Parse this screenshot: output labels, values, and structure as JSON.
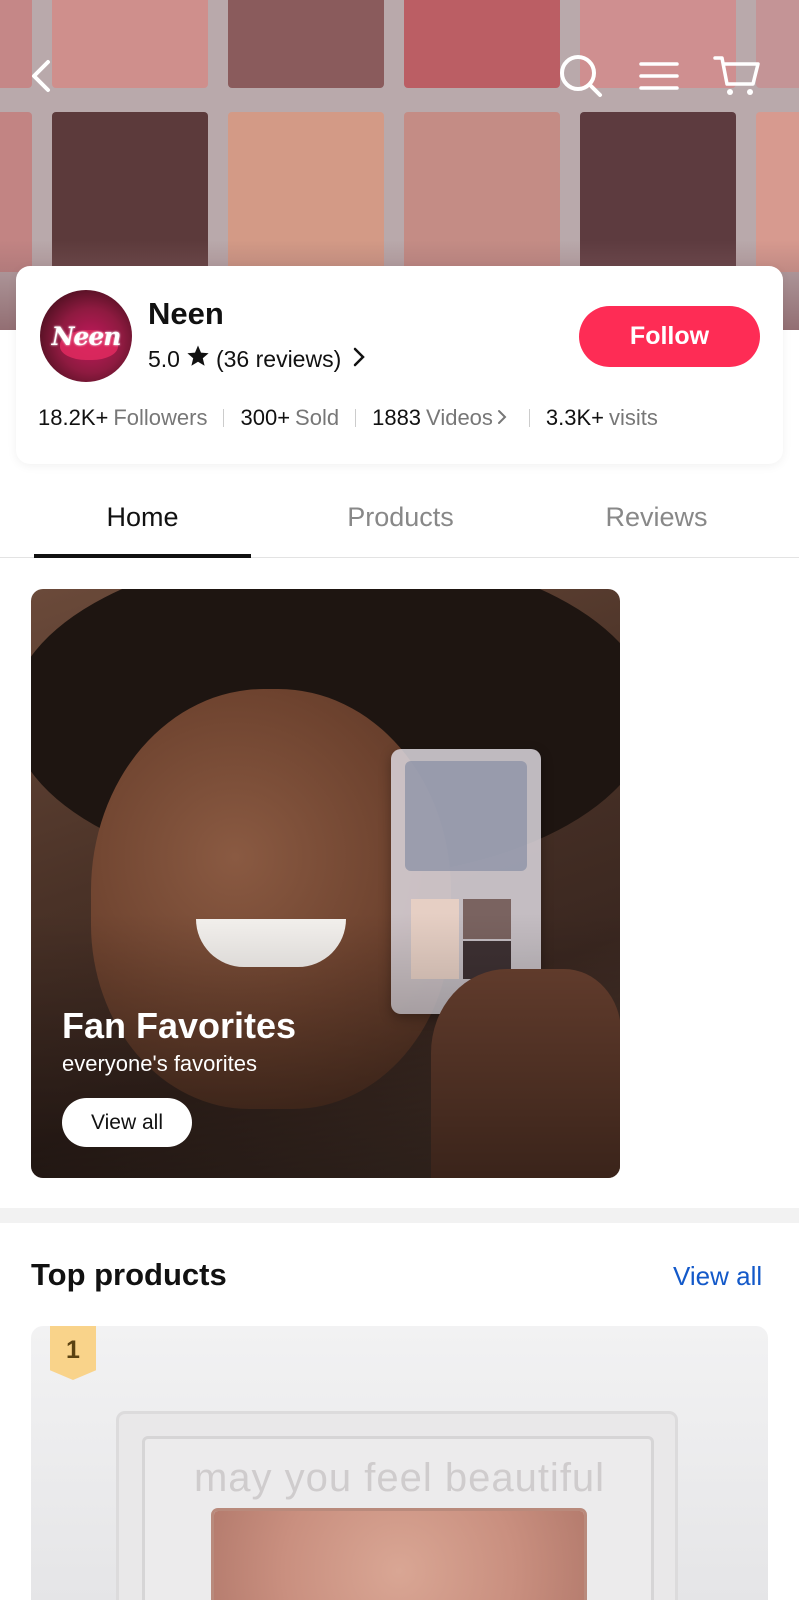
{
  "header": {
    "back_icon": "chevron-left-icon",
    "icons": [
      "search-icon",
      "menu-icon",
      "cart-icon"
    ]
  },
  "shop": {
    "avatar_text": "Neen",
    "name": "Neen",
    "rating": "5.0",
    "reviews": "(36 reviews)",
    "follow_label": "Follow",
    "stats": {
      "followers_value": "18.2K+",
      "followers_label": "Followers",
      "sold_value": "300+",
      "sold_label": "Sold",
      "videos_value": "1883",
      "videos_label": "Videos",
      "visits_value": "3.3K+",
      "visits_label": "visits"
    }
  },
  "tabs": {
    "home": "Home",
    "products": "Products",
    "reviews": "Reviews",
    "active": "Home"
  },
  "banner": {
    "title": "Fan Favorites",
    "subtitle": "everyone's favorites",
    "button_label": "View all"
  },
  "top_products": {
    "title": "Top products",
    "view_all": "View all",
    "first_product": {
      "rank": "1",
      "palette_text": "may you feel beautiful"
    }
  },
  "colors": {
    "accent": "#fe2c55",
    "link": "#1359c9",
    "rank_badge": "#f9d38a"
  }
}
